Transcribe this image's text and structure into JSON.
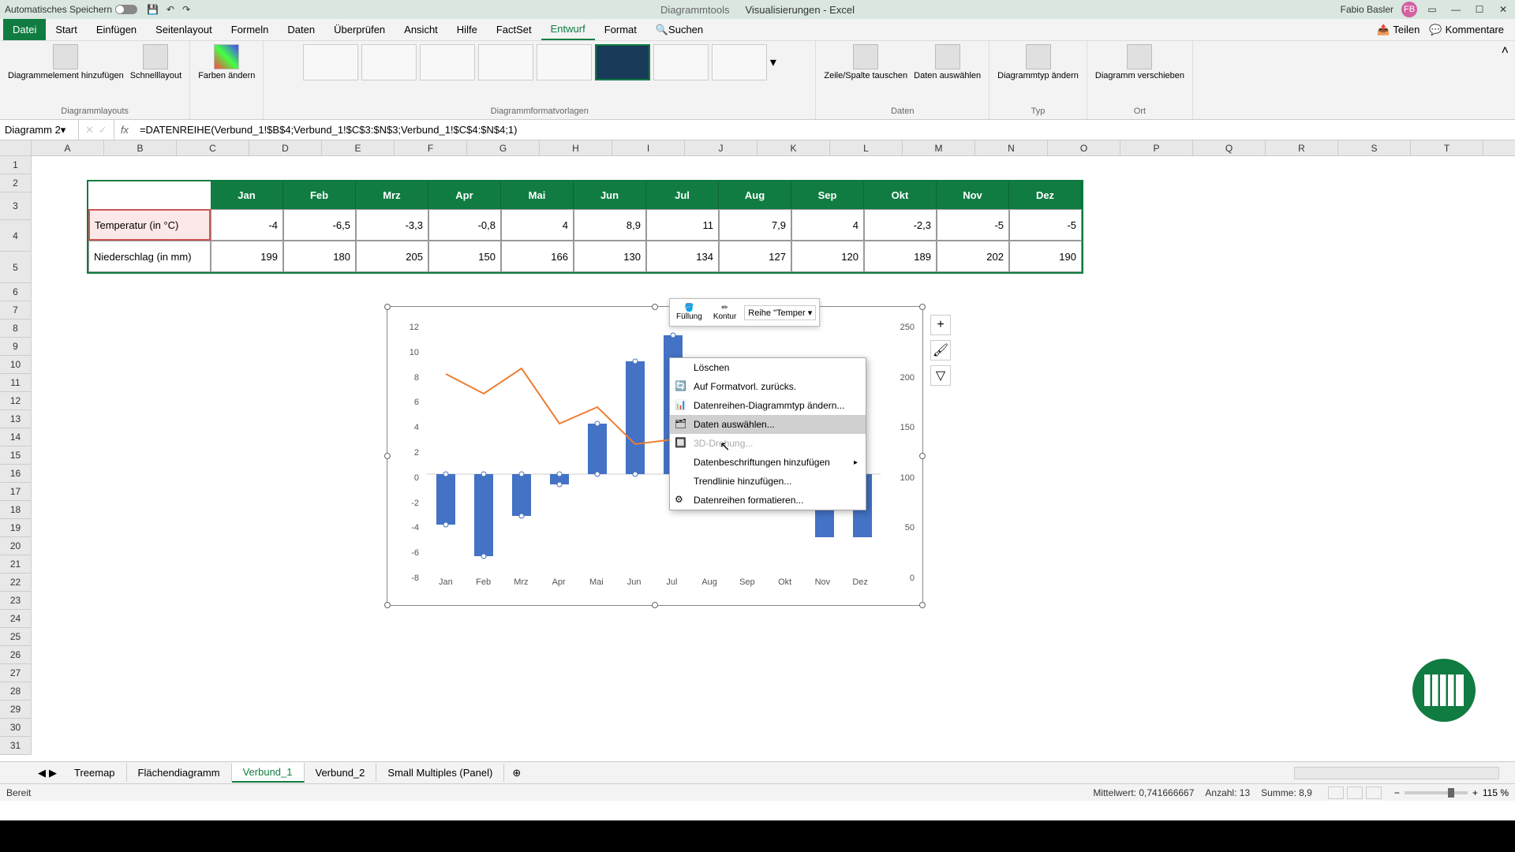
{
  "title_bar": {
    "autosave_label": "Automatisches Speichern",
    "chart_tools": "Diagrammtools",
    "doc_title": "Visualisierungen - Excel",
    "user_name": "Fabio Basler",
    "user_initials": "FB"
  },
  "menu": {
    "datei": "Datei",
    "items": [
      "Start",
      "Einfügen",
      "Seitenlayout",
      "Formeln",
      "Daten",
      "Überprüfen",
      "Ansicht",
      "Hilfe",
      "FactSet",
      "Entwurf",
      "Format"
    ],
    "active": "Entwurf",
    "search": "Suchen",
    "teilen": "Teilen",
    "kommentare": "Kommentare"
  },
  "ribbon": {
    "group1": {
      "btn1": "Diagrammelement hinzufügen",
      "btn2": "Schnelllayout",
      "label": "Diagrammlayouts"
    },
    "group2": {
      "btn1": "Farben ändern"
    },
    "group3": {
      "label": "Diagrammformatvorlagen"
    },
    "group4": {
      "btn1": "Zeile/Spalte tauschen",
      "btn2": "Daten auswählen",
      "label": "Daten"
    },
    "group5": {
      "btn1": "Diagrammtyp ändern",
      "label": "Typ"
    },
    "group6": {
      "btn1": "Diagramm verschieben",
      "label": "Ort"
    }
  },
  "formula_bar": {
    "name_box": "Diagramm 2",
    "formula": "=DATENREIHE(Verbund_1!$B$4;Verbund_1!$C$3:$N$3;Verbund_1!$C$4:$N$4;1)"
  },
  "columns": [
    "A",
    "B",
    "C",
    "D",
    "E",
    "F",
    "G",
    "H",
    "I",
    "J",
    "K",
    "L",
    "M",
    "N",
    "O",
    "P",
    "Q",
    "R",
    "S",
    "T"
  ],
  "table": {
    "months": [
      "Jan",
      "Feb",
      "Mrz",
      "Apr",
      "Mai",
      "Jun",
      "Jul",
      "Aug",
      "Sep",
      "Okt",
      "Nov",
      "Dez"
    ],
    "row1_label": "Temperatur (in °C)",
    "row1": [
      "-4",
      "-6,5",
      "-3,3",
      "-0,8",
      "4",
      "8,9",
      "11",
      "7,9",
      "4",
      "-2,3",
      "-5",
      "-5"
    ],
    "row2_label": "Niederschlag (in mm)",
    "row2": [
      "199",
      "180",
      "205",
      "150",
      "166",
      "130",
      "134",
      "127",
      "120",
      "189",
      "202",
      "190"
    ]
  },
  "mini_toolbar": {
    "fullung": "Füllung",
    "kontur": "Kontur",
    "series_selector": "Reihe \"Temper"
  },
  "context_menu": {
    "loschen": "Löschen",
    "auf_format": "Auf Formatvorl. zurücks.",
    "typ_andern": "Datenreihen-Diagrammtyp ändern...",
    "daten_auswahlen": "Daten auswählen...",
    "dreid": "3D-Drehung...",
    "beschriftungen": "Datenbeschriftungen hinzufügen",
    "trendlinie": "Trendlinie hinzufügen...",
    "formatieren": "Datenreihen formatieren..."
  },
  "sheet_tabs": [
    "Treemap",
    "Flächendiagramm",
    "Verbund_1",
    "Verbund_2",
    "Small Multiples (Panel)"
  ],
  "sheet_active": "Verbund_1",
  "status": {
    "ready": "Bereit",
    "mittelwert": "Mittelwert: 0,741666667",
    "anzahl": "Anzahl: 13",
    "summe": "Summe: 8,9",
    "zoom": "115 %"
  },
  "chart_data": {
    "type": "combo",
    "categories": [
      "Jan",
      "Feb",
      "Mrz",
      "Apr",
      "Mai",
      "Jun",
      "Jul",
      "Aug",
      "Sep",
      "Okt",
      "Nov",
      "Dez"
    ],
    "series": [
      {
        "name": "Temperatur (in °C)",
        "type": "bar",
        "axis": "primary",
        "values": [
          -4,
          -6.5,
          -3.3,
          -0.8,
          4,
          8.9,
          11,
          7.9,
          4,
          -2.3,
          -5,
          -5
        ]
      },
      {
        "name": "Niederschlag (in mm)",
        "type": "line",
        "axis": "secondary",
        "values": [
          199,
          180,
          205,
          150,
          166,
          130,
          134,
          127,
          120,
          189,
          202,
          190
        ]
      }
    ],
    "y_primary": {
      "min": -8,
      "max": 12,
      "ticks": [
        -8,
        -6,
        -4,
        -2,
        0,
        2,
        4,
        6,
        8,
        10,
        12
      ]
    },
    "y_secondary": {
      "min": 0,
      "max": 250,
      "ticks": [
        0,
        50,
        100,
        150,
        200,
        250
      ]
    }
  }
}
